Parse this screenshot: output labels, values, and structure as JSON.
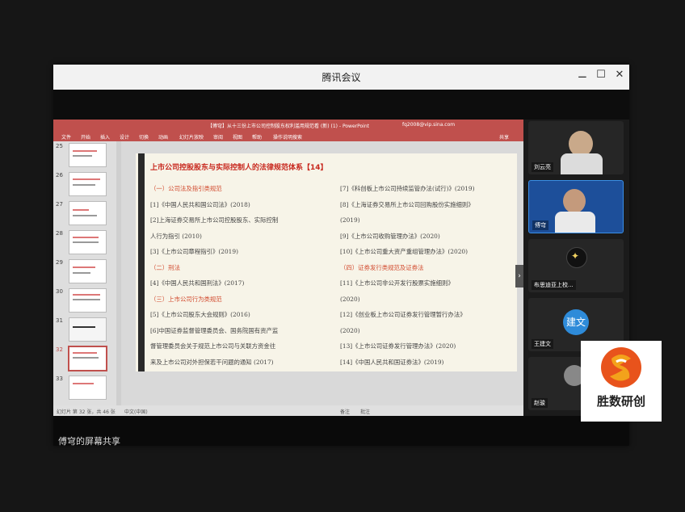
{
  "window": {
    "title": "腾讯会议",
    "controls": [
      "⚊",
      "☐",
      "✕"
    ]
  },
  "powerpoint": {
    "title_text": "【傅穹】从十三份上市公司控制股东权利滥用规范看 (新) (1) - PowerPoint",
    "account": "fq2008@vip.sina.com",
    "ribbon_tabs": [
      "文件",
      "开始",
      "插入",
      "设计",
      "切换",
      "动画",
      "幻灯片放映",
      "审阅",
      "视图",
      "帮助",
      "操作说明搜索"
    ],
    "share_label": "共享",
    "thumbnails": [
      "25",
      "26",
      "27",
      "28",
      "29",
      "30",
      "31",
      "32",
      "33"
    ],
    "active_slide": "32",
    "status_left": "幻灯片 第 32 张，共 46 张",
    "status_lang": "中文(中国)",
    "status_notes": "备注",
    "status_comments": "批注"
  },
  "slide": {
    "heading": "上市公司控股股东与实际控制人的法律规范体系【14】",
    "left_lines": [
      {
        "text": "（一）公司法及指引类规范",
        "red": true
      },
      {
        "text": "[1]《中国人民共和国公司法》(2018)",
        "red": false
      },
      {
        "text": "[2]上海证券交易所上市公司控股股东、实际控制",
        "red": false
      },
      {
        "text": "人行为指引 (2010)",
        "red": false
      },
      {
        "text": "[3]《上市公司章程指引》(2019)",
        "red": false
      },
      {
        "text": "（二）刑法",
        "red": true
      },
      {
        "text": "[4]《中国人民共和国刑法》(2017)",
        "red": false
      },
      {
        "text": "（三）上市公司行为类规范",
        "red": true
      },
      {
        "text": "[5]《上市公司股东大会规则》(2016)",
        "red": false
      },
      {
        "text": "[6]中国证券监督管理委员会、国务院国有资产监",
        "red": false
      },
      {
        "text": "督管理委员会关于规范上市公司与关联方资金往",
        "red": false
      },
      {
        "text": "来及上市公司对外担保若干问题的通知 (2017)",
        "red": false
      }
    ],
    "right_lines": [
      {
        "text": "[7]《科创板上市公司持续监管办法(试行)》(2019)",
        "red": false
      },
      {
        "text": "[8]《上海证券交易所上市公司回购股份实施细则》",
        "red": false
      },
      {
        "text": "(2019)",
        "red": false
      },
      {
        "text": "[9]《上市公司收购管理办法》(2020)",
        "red": false
      },
      {
        "text": "[10]《上市公司重大资产重组管理办法》(2020)",
        "red": false
      },
      {
        "text": "（四）证券发行类规范及证券法",
        "red": true
      },
      {
        "text": "[11]《上市公司非公开发行股票实施细则》",
        "red": false
      },
      {
        "text": "(2020)",
        "red": false
      },
      {
        "text": "[12]《创业板上市公司证券发行管理暂行办法》",
        "red": false
      },
      {
        "text": "(2020)",
        "red": false
      },
      {
        "text": "[13]《上市公司证券发行管理办法》(2020)",
        "red": false
      },
      {
        "text": "[14]《中国人民共和国证券法》(2019)",
        "red": false
      }
    ]
  },
  "participants": [
    {
      "name": "刘云亮"
    },
    {
      "name": "傅穹"
    },
    {
      "name": "布思迪亚上校..."
    },
    {
      "name": "王建文",
      "avatar": "建文"
    },
    {
      "name": "赵骏"
    }
  ],
  "footer": {
    "share_label": "傅穹的屏幕共享"
  },
  "watermark": {
    "text": "胜数研创",
    "colors": [
      "#e8531c",
      "#f3a21b"
    ]
  }
}
